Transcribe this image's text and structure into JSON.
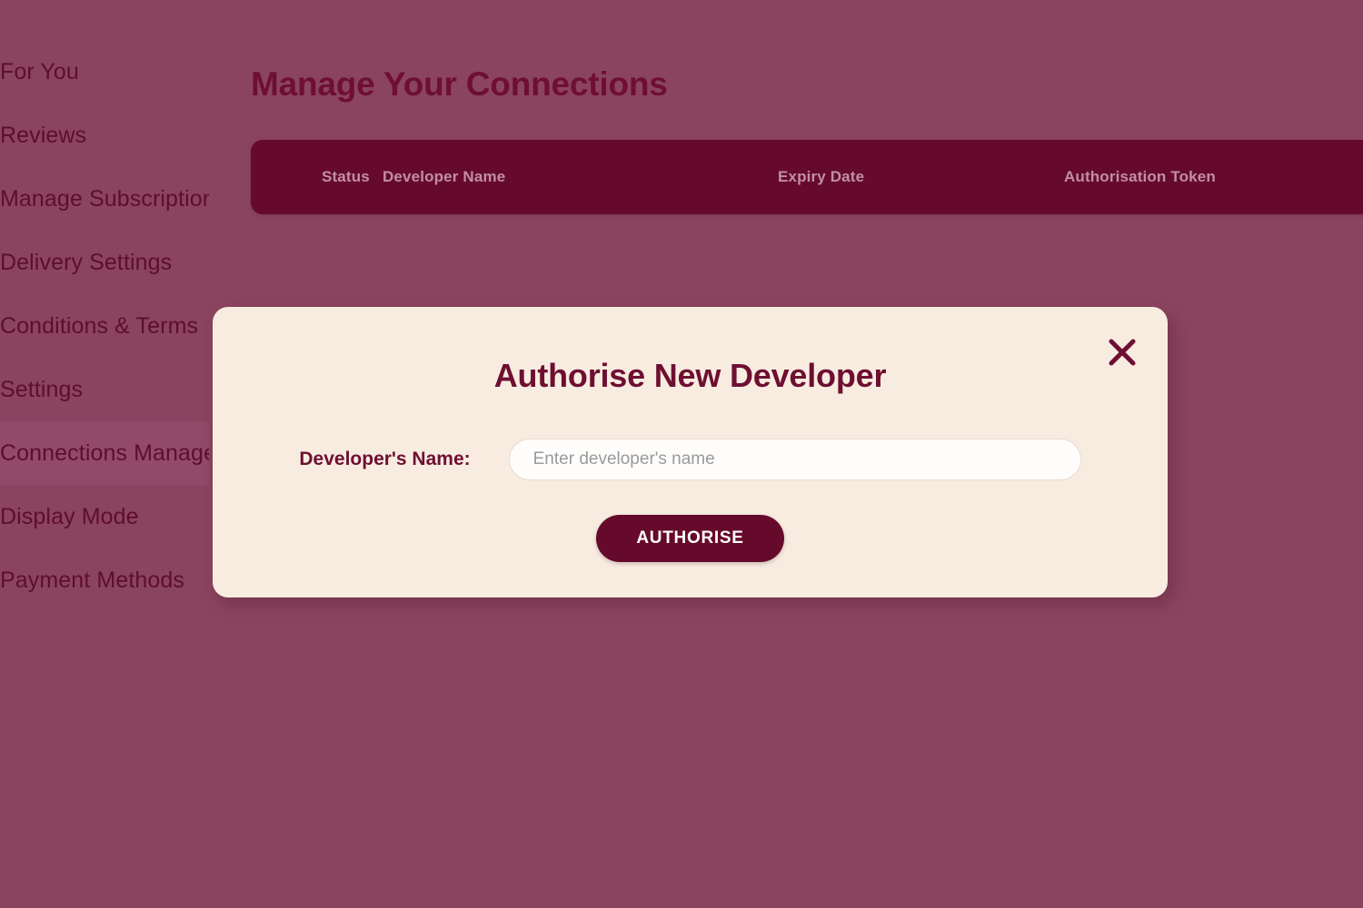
{
  "theme": {
    "page_background": "#8B4460",
    "accent_dark": "#660A2B",
    "title_color": "#6E0F32",
    "modal_background": "#F8ECE1",
    "table_header_text": "#C08FA1",
    "sidebar_active_background": "#92496A"
  },
  "sidebar": {
    "items": [
      {
        "label": "For You",
        "active": false
      },
      {
        "label": "Reviews",
        "active": false
      },
      {
        "label": "Manage Subscription",
        "active": false
      },
      {
        "label": "Delivery Settings",
        "active": false
      },
      {
        "label": "Conditions & Terms",
        "active": false
      },
      {
        "label": "Settings",
        "active": false
      },
      {
        "label": "Connections Manager",
        "active": true
      },
      {
        "label": "Display Mode",
        "active": false
      },
      {
        "label": "Payment Methods",
        "active": false
      }
    ]
  },
  "main": {
    "page_title": "Manage Your Connections",
    "table": {
      "columns": [
        {
          "key": "status",
          "label": "Status"
        },
        {
          "key": "developer_name",
          "label": "Developer Name"
        },
        {
          "key": "expiry_date",
          "label": "Expiry Date"
        },
        {
          "key": "auth_token",
          "label": "Authorisation Token"
        }
      ],
      "rows": []
    }
  },
  "modal": {
    "title": "Authorise New Developer",
    "close_icon": "close-icon",
    "field": {
      "label": "Developer's Name:",
      "value": "",
      "placeholder": "Enter developer's name"
    },
    "submit_label": "AUTHORISE"
  }
}
